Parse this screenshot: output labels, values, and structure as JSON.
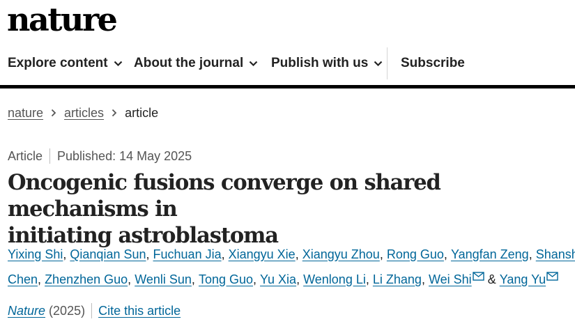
{
  "site": {
    "logo": "nature"
  },
  "nav": {
    "items": [
      {
        "label": "Explore content",
        "dropdown": true
      },
      {
        "label": "About the journal",
        "dropdown": true
      },
      {
        "label": "Publish with us",
        "dropdown": true
      },
      {
        "label": "Subscribe",
        "dropdown": false
      }
    ]
  },
  "breadcrumb": {
    "items": [
      "nature",
      "articles"
    ],
    "current": "article"
  },
  "article": {
    "type": "Article",
    "published": "Published: 14 May 2025",
    "title_line1": "Oncogenic fusions converge on shared mechanisms in",
    "title_line2": "initiating astroblastoma",
    "authors_line1": [
      "Yixing Shi",
      "Qianqian Sun",
      "Fuchuan Jia",
      "Xiangyu Xie",
      "Xiangyu Zhou",
      "Rong Guo",
      "Yangfan Zeng",
      "Shanshan"
    ],
    "authors_line2a": [
      "Chen",
      "Zhenzhen Guo",
      "Wenli Sun",
      "Tong Guo",
      "Yu Xia",
      "Wenlong Li",
      "Li Zhang",
      "Wei Shi"
    ],
    "separator": ",",
    "ampersand": "&",
    "last_author": "Yang Yu",
    "journal": "Nature",
    "year": "(2025)",
    "cite_label": "Cite this article"
  },
  "colors": {
    "link": "#006699",
    "text": "#222222",
    "muted": "#555555",
    "rule": "#000000"
  },
  "icons": {
    "dropdown": "chevron-down-icon",
    "breadcrumb": "chevron-right-icon",
    "contact": "mail-icon"
  }
}
